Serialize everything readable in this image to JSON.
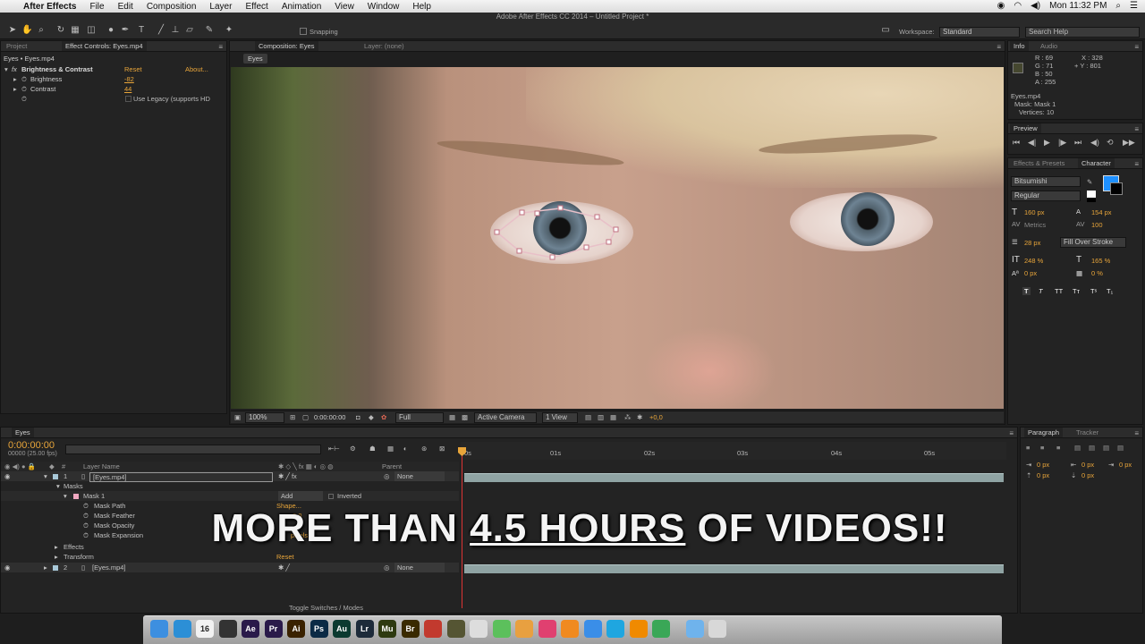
{
  "menubar": {
    "app": "After Effects",
    "items": [
      "File",
      "Edit",
      "Composition",
      "Layer",
      "Effect",
      "Animation",
      "View",
      "Window",
      "Help"
    ],
    "clock": "Mon 11:32 PM"
  },
  "window_title": "Adobe After Effects CC 2014 – Untitled Project *",
  "toolbar": {
    "snapping_label": "Snapping",
    "workspace_label": "Workspace:",
    "workspace_value": "Standard",
    "search_placeholder": "Search Help"
  },
  "left_panel": {
    "tab_project": "Project",
    "tab_effect_controls": "Effect Controls: Eyes.mp4",
    "breadcrumb": "Eyes • Eyes.mp4",
    "effect_name": "Brightness & Contrast",
    "reset": "Reset",
    "about": "About...",
    "brightness_label": "Brightness",
    "brightness_value": "-82",
    "contrast_label": "Contrast",
    "contrast_value": "44",
    "legacy_label": "Use Legacy (supports HD"
  },
  "comp_panel": {
    "tab_composition": "Composition: Eyes",
    "tab_layer": "Layer: (none)",
    "comp_chip": "Eyes",
    "zoom": "100%",
    "timecode": "0:00:00:00",
    "resolution": "Full",
    "camera": "Active Camera",
    "view": "1 View",
    "exposure": "+0,0"
  },
  "info_panel": {
    "tab_info": "Info",
    "tab_audio": "Audio",
    "r": "R : 69",
    "g": "G : 71",
    "b": "B : 50",
    "a": "A : 255",
    "x": "X : 328",
    "y": "+ Y : 801",
    "layer_line": "Eyes.mp4",
    "mask_line": "Mask: Mask 1",
    "vertices_line": "Vertices: 10",
    "swatch_color": "#45472f"
  },
  "preview_panel": {
    "tab": "Preview"
  },
  "character_panel": {
    "tab_effects": "Effects & Presets",
    "tab_character": "Character",
    "font": "Bitsumishi",
    "style": "Regular",
    "size": "160 px",
    "leading": "154 px",
    "kerning": "Metrics",
    "tracking": "100",
    "stroke_width": "28 px",
    "stroke_mode": "Fill Over Stroke",
    "vscale": "248 %",
    "hscale": "165 %",
    "baseline": "0 px",
    "tsume": "0 %",
    "fill_color": "#1e90ff"
  },
  "timeline": {
    "tab": "Eyes",
    "timecode": "0:00:00:00",
    "fps": "00000 (25.00 fps)",
    "col_name": "Layer Name",
    "col_parent": "Parent",
    "ruler": [
      "0s",
      "01s",
      "02s",
      "03s",
      "04s",
      "05s"
    ],
    "layer1": {
      "num": "1",
      "name": "[Eyes.mp4]",
      "parent": "None"
    },
    "masks_label": "Masks",
    "mask1": {
      "name": "Mask 1",
      "mode": "Add",
      "inverted": "Inverted"
    },
    "mask_path": {
      "label": "Mask Path",
      "value": "Shape..."
    },
    "mask_feather": {
      "label": "Mask Feather",
      "value": "0,0"
    },
    "mask_opacity": {
      "label": "Mask Opacity",
      "value": ""
    },
    "mask_expansion": {
      "label": "Mask Expansion",
      "value": "pixels"
    },
    "effects_label": "Effects",
    "transform_label": "Transform",
    "transform_reset": "Reset",
    "layer2": {
      "num": "2",
      "name": "[Eyes.mp4]",
      "parent": "None"
    },
    "toggle_label": "Toggle Switches / Modes"
  },
  "paragraph_panel": {
    "tab_paragraph": "Paragraph",
    "tab_tracker": "Tracker",
    "indent_left": "0 px",
    "indent_right": "0 px",
    "indent_first": "0 px",
    "space_before": "0 px",
    "space_after": "0 px"
  },
  "overlay": {
    "pre": "MORE THAN ",
    "highlight": "4.5 HOURS",
    "post": " OF VIDEOS!!"
  },
  "dock": {
    "apps": [
      {
        "icon": "finder-icon",
        "label": "",
        "color": "#3d8fe0"
      },
      {
        "icon": "safari-icon",
        "label": "",
        "color": "#2c8fd6"
      },
      {
        "icon": "calendar-icon",
        "label": "16",
        "color": "#f2f2f2"
      },
      {
        "icon": "clapper-icon",
        "label": "",
        "color": "#333"
      },
      {
        "icon": "after-effects-icon",
        "label": "Ae",
        "color": "#2a1a4a"
      },
      {
        "icon": "premiere-icon",
        "label": "Pr",
        "color": "#2a1a4a"
      },
      {
        "icon": "illustrator-icon",
        "label": "Ai",
        "color": "#3a2200"
      },
      {
        "icon": "photoshop-icon",
        "label": "Ps",
        "color": "#0b2a45"
      },
      {
        "icon": "audition-icon",
        "label": "Au",
        "color": "#0b3a30"
      },
      {
        "icon": "lightroom-icon",
        "label": "Lr",
        "color": "#1d2b3a"
      },
      {
        "icon": "muse-icon",
        "label": "Mu",
        "color": "#2e3a10"
      },
      {
        "icon": "bridge-icon",
        "label": "Br",
        "color": "#3a2a00"
      },
      {
        "icon": "davinci-icon",
        "label": "",
        "color": "#c23a2e"
      },
      {
        "icon": "compressor-icon",
        "label": "",
        "color": "#553"
      },
      {
        "icon": "preview-icon",
        "label": "",
        "color": "#ddd"
      },
      {
        "icon": "messages-icon",
        "label": "",
        "color": "#5cc05c"
      },
      {
        "icon": "photos-icon",
        "label": "",
        "color": "#e8a040"
      },
      {
        "icon": "itunes-icon",
        "label": "",
        "color": "#e04070"
      },
      {
        "icon": "books-icon",
        "label": "",
        "color": "#f08a20"
      },
      {
        "icon": "appstore-icon",
        "label": "",
        "color": "#3a8ee8"
      },
      {
        "icon": "skype-icon",
        "label": "",
        "color": "#1fa6e0"
      },
      {
        "icon": "vlc-icon",
        "label": "",
        "color": "#f08a00"
      },
      {
        "icon": "chrome-icon",
        "label": "",
        "color": "#3aa757"
      },
      {
        "icon": "folder-icon",
        "label": "",
        "color": "#6fb3ec"
      },
      {
        "icon": "trash-icon",
        "label": "",
        "color": "#d8d8d8"
      }
    ]
  }
}
